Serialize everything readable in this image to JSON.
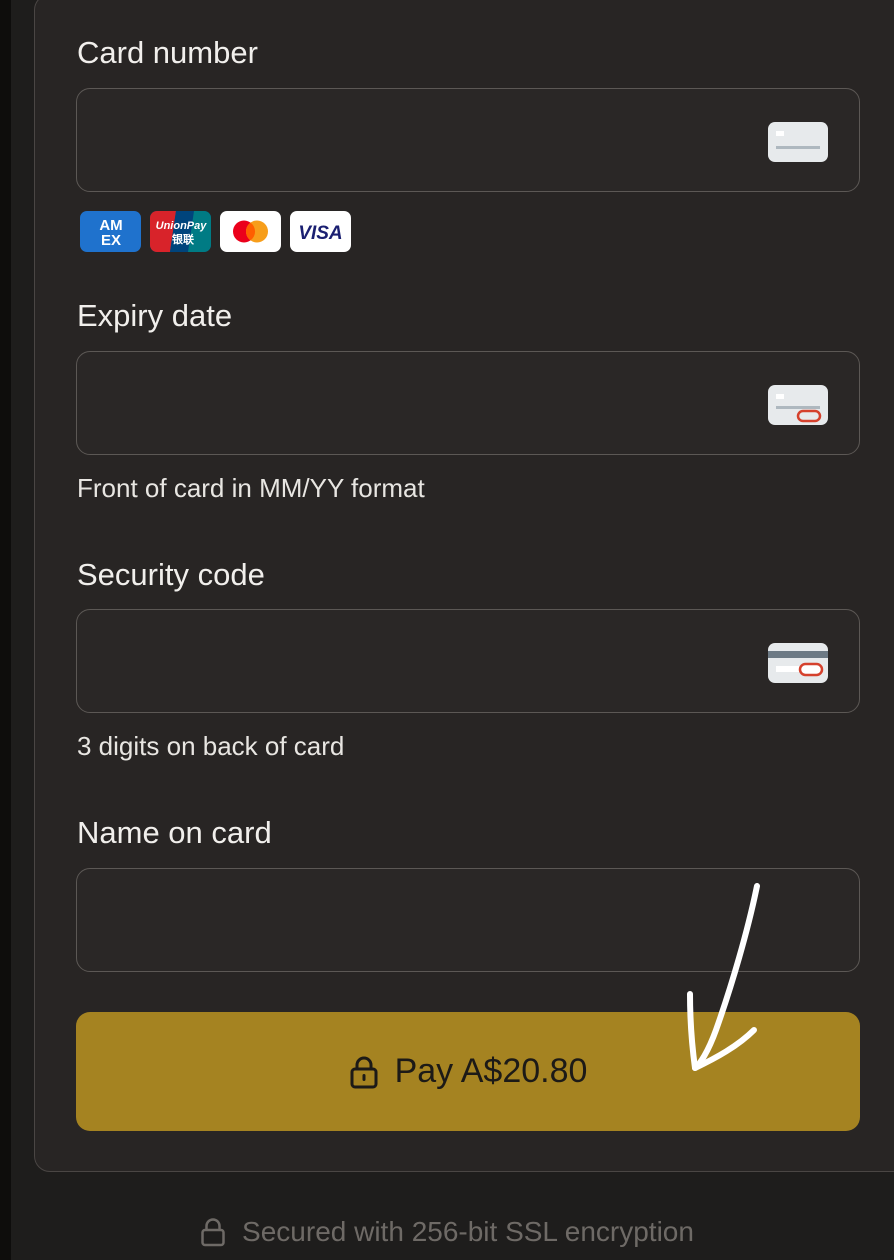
{
  "card_number": {
    "label": "Card number",
    "value": "",
    "placeholder": "",
    "icon": "card-front-icon"
  },
  "accepted_brands": [
    {
      "name": "American Express",
      "mark": "AM EX",
      "icon": "amex-logo"
    },
    {
      "name": "UnionPay",
      "mark": "UnionPay 银联",
      "icon": "unionpay-logo"
    },
    {
      "name": "Mastercard",
      "mark": "",
      "icon": "mastercard-logo"
    },
    {
      "name": "Visa",
      "mark": "VISA",
      "icon": "visa-logo"
    }
  ],
  "expiry_date": {
    "label": "Expiry date",
    "value": "",
    "placeholder": "",
    "hint": "Front of card in MM/YY format",
    "icon": "card-expiry-icon"
  },
  "security_code": {
    "label": "Security code",
    "value": "",
    "placeholder": "",
    "hint": "3 digits on back of card",
    "icon": "card-back-cvc-icon"
  },
  "name_on_card": {
    "label": "Name on card",
    "value": "",
    "placeholder": ""
  },
  "pay_button": {
    "label": "Pay A$20.80",
    "icon": "lock-icon"
  },
  "footer": {
    "text": "Secured with 256-bit SSL encryption",
    "icon": "lock-icon"
  },
  "annotation": {
    "icon": "hand-drawn-arrow-icon"
  },
  "colors": {
    "background": "#1e1d1c",
    "panel": "#282524",
    "field_border": "#5c5855",
    "text": "#f1efec",
    "pay_button": "#a58321",
    "pay_button_text": "#1c1a17",
    "footer_text": "#6e6a66",
    "annotation_arrow": "#ffffff",
    "amex_blue": "#1f72cd",
    "unionpay_red": "#d8232a",
    "unionpay_blue": "#00447c",
    "unionpay_teal": "#007b84",
    "mastercard_red": "#eb001b",
    "mastercard_orange": "#f79e1b",
    "visa_blue": "#1a1f71",
    "cvc_outline_red": "#d5412d"
  }
}
